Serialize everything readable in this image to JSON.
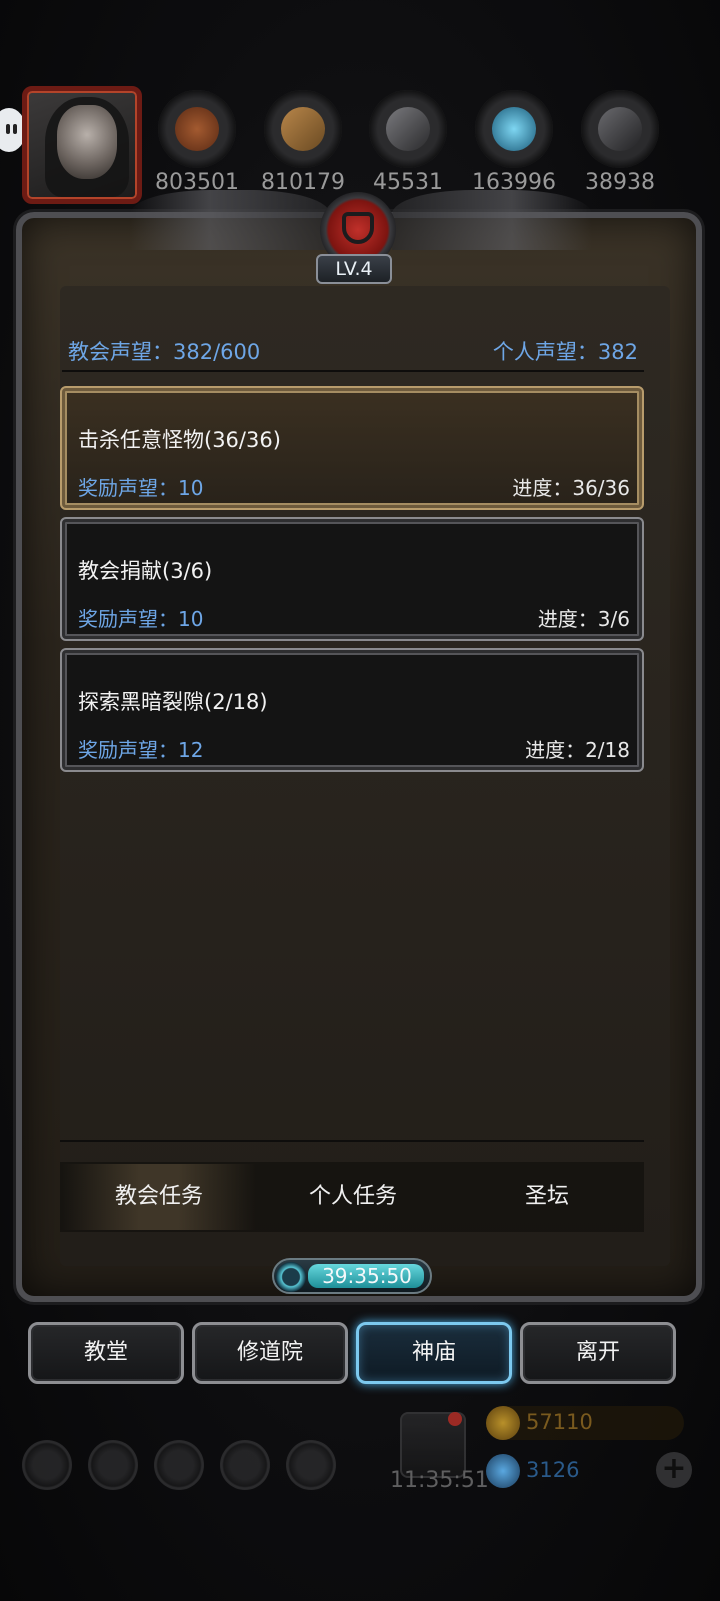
{
  "resources": [
    {
      "name": "wood-ore",
      "value": "803501",
      "color": "#8a4a2a"
    },
    {
      "name": "timber",
      "value": "810179",
      "color": "#8a6a3a"
    },
    {
      "name": "iron",
      "value": "45531",
      "color": "#5a5a5e"
    },
    {
      "name": "crystal",
      "value": "163996",
      "color": "#2e8aa8"
    },
    {
      "name": "stone",
      "value": "38938",
      "color": "#4d4d50"
    }
  ],
  "level_badge": "LV.4",
  "reputation": {
    "church": "教会声望：382/600",
    "personal": "个人声望：382"
  },
  "tasks": [
    {
      "title": "击杀任意怪物(36/36)",
      "reward": "奖励声望：10",
      "progress": "进度：36/36",
      "active": true
    },
    {
      "title": "教会捐献(3/6)",
      "reward": "奖励声望：10",
      "progress": "进度：3/6",
      "active": false
    },
    {
      "title": "探索黑暗裂隙(2/18)",
      "reward": "奖励声望：12",
      "progress": "进度：2/18",
      "active": false
    }
  ],
  "tabs": [
    "教会任务",
    "个人任务",
    "圣坛"
  ],
  "active_tab": 0,
  "timer": "39:35:50",
  "nav": [
    "教堂",
    "修道院",
    "神庙",
    "离开"
  ],
  "active_nav": 2,
  "bottom": {
    "clock": "11:35:51",
    "gold": "57110",
    "gems": "3126",
    "gold_color": "#7a5a1e",
    "gem_color": "#2a5a8a"
  },
  "colors": {
    "reputation_text": "#6ea6e6",
    "active_nav_glow": "#7cc9ef"
  }
}
